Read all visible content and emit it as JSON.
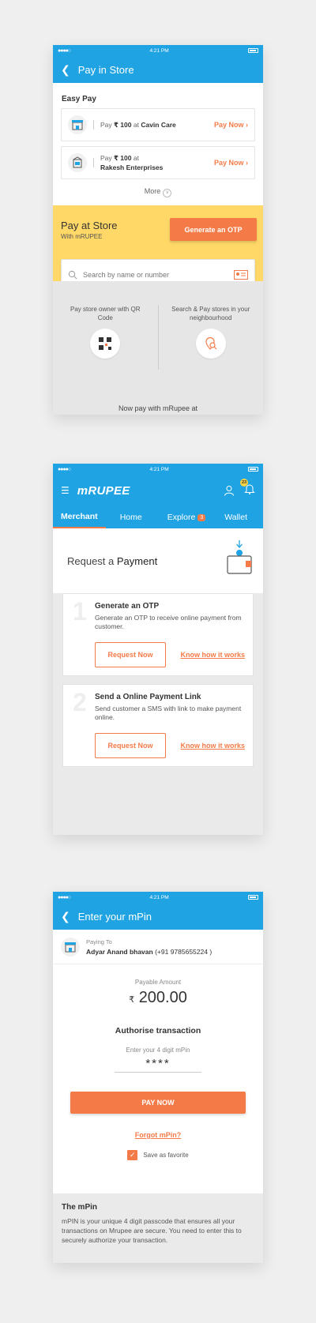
{
  "colors": {
    "primary": "#1fa3e3",
    "accent": "#f47b48",
    "yellow": "#ffd867"
  },
  "screen1": {
    "time": "4:21 PM",
    "title": "Pay in Store",
    "easy_pay_title": "Easy Pay",
    "items": [
      {
        "prefix": "Pay",
        "amount": "₹ 100",
        "at": "at",
        "merchant": "Cavin Care",
        "action": "Pay Now"
      },
      {
        "prefix": "Pay",
        "amount": "₹ 100",
        "at": "at",
        "merchant": "Rakesh Enterprises",
        "action": "Pay Now"
      }
    ],
    "more": "More",
    "pay_at_store": "Pay at Store",
    "with_mrupee": "With mRUPEE",
    "otp_button": "Generate an OTP",
    "search_placeholder": "Search by name or number",
    "col1": "Pay store owner with QR Code",
    "col2": "Search & Pay stores in your neighbourhood",
    "footer": "Now pay with mRupee at"
  },
  "screen2": {
    "time": "4:21 PM",
    "logo": "mRUPEE",
    "notif_count": "23",
    "tabs": [
      {
        "label": "Merchant"
      },
      {
        "label": "Home"
      },
      {
        "label": "Explore",
        "badge": "3"
      },
      {
        "label": "Wallet"
      }
    ],
    "heading_pre": "Request a",
    "heading_bold": "Payment",
    "steps": [
      {
        "num": "1",
        "title": "Generate an OTP",
        "desc": "Generate an OTP to receive online payment from customer.",
        "button": "Request Now",
        "link": "Know how it works"
      },
      {
        "num": "2",
        "title": "Send a Online Payment Link",
        "desc": "Send customer a SMS with link to make payment online.",
        "button": "Request Now",
        "link": "Know how it works"
      }
    ]
  },
  "screen3": {
    "time": "4:21 PM",
    "title": "Enter your mPin",
    "paying_to_label": "Paying To",
    "payee_name": "Adyar Anand bhavan",
    "payee_phone": "(+91 9785655224 )",
    "payable_label": "Payable Amount",
    "currency": "₹",
    "amount": "200.00",
    "authorise": "Authorise transaction",
    "mpin_label": "Enter your 4 digit mPin",
    "mpin_value": "****",
    "pay_now": "PAY NOW",
    "forgot": "Forgot mPin?",
    "save_fav": "Save as favorite",
    "info_title": "The mPin",
    "info_text": "mPIN is your unique 4 digit passcode that ensures all your transactions on Mrupee are secure. You need to enter this to securely authorize your transaction."
  }
}
